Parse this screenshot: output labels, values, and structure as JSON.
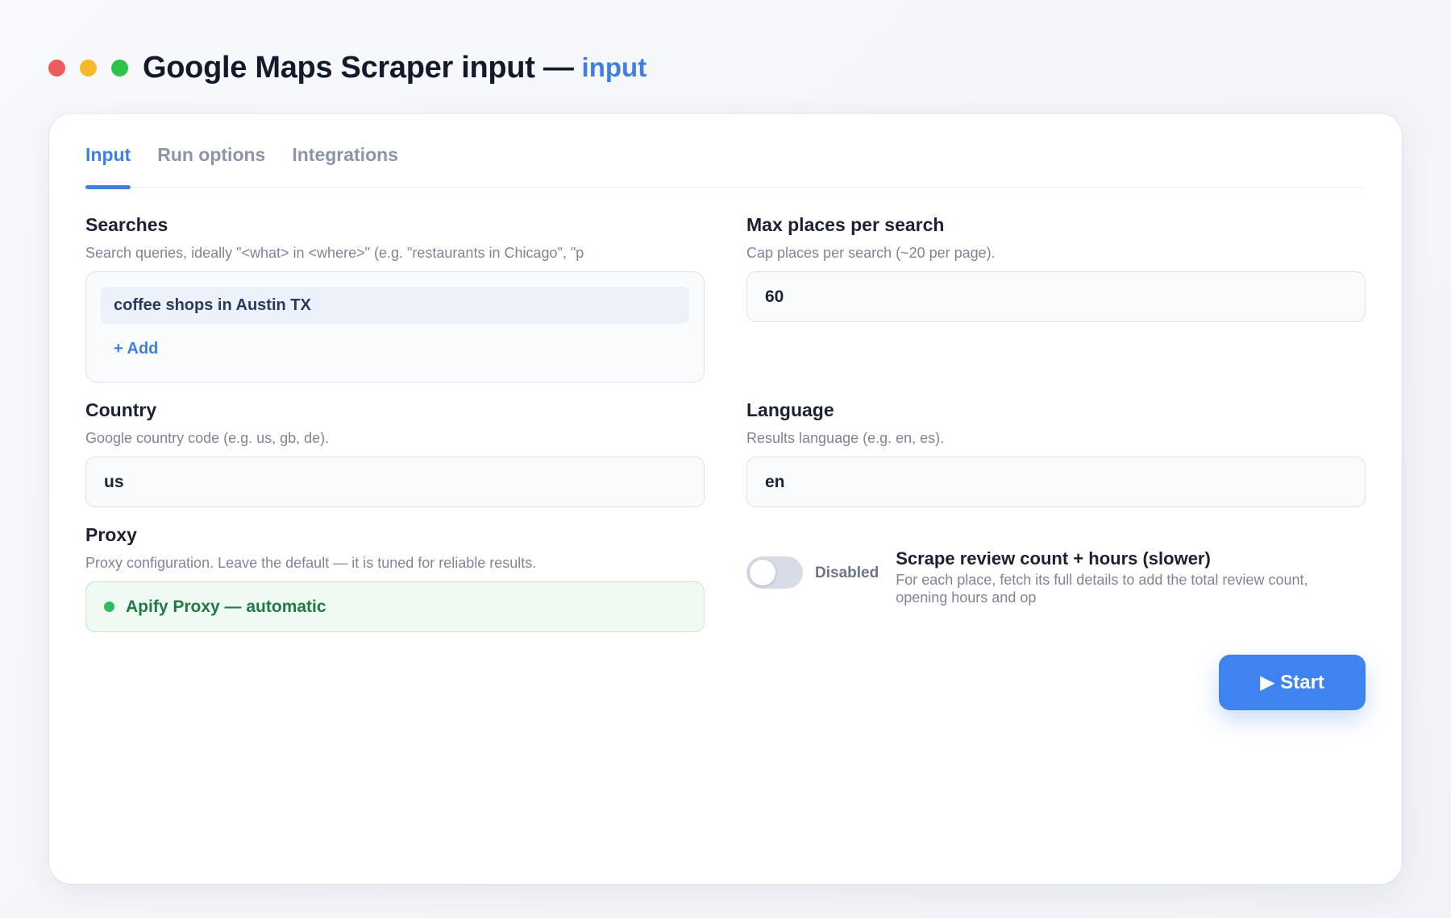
{
  "window": {
    "title": "Google Maps Scraper input —",
    "subtitle": "input"
  },
  "tabs": [
    {
      "label": "Input",
      "active": true
    },
    {
      "label": "Run options",
      "active": false
    },
    {
      "label": "Integrations",
      "active": false
    }
  ],
  "searches": {
    "label": "Searches",
    "help": "Search queries, ideally \"<what> in <where>\" (e.g. \"restaurants in Chicago\", \"p",
    "items": [
      "coffee shops in Austin TX"
    ],
    "add_label": "+ Add"
  },
  "max_places": {
    "label": "Max places per search",
    "help": "Cap places per search (~20 per page).",
    "value": "60"
  },
  "country": {
    "label": "Country",
    "help": "Google country code (e.g. us, gb, de).",
    "value": "us"
  },
  "language": {
    "label": "Language",
    "help": "Results language (e.g. en, es).",
    "value": "en"
  },
  "proxy": {
    "label": "Proxy",
    "help": "Proxy configuration. Leave the default — it is tuned for reliable results.",
    "value": "Apify Proxy — automatic"
  },
  "review_toggle": {
    "state": "Disabled",
    "enabled": false,
    "title": "Scrape review count + hours (slower)",
    "description": "For each place, fetch its full details to add the total review count, opening hours and op"
  },
  "start_button": {
    "label": "▶ Start"
  },
  "colors": {
    "accent": "#3f7fe0",
    "button": "#3f83f0",
    "proxy_ok": "#2fbb5e",
    "window_red": "#ef5b5b",
    "window_yellow": "#f7b928",
    "window_green": "#2fc24a"
  }
}
